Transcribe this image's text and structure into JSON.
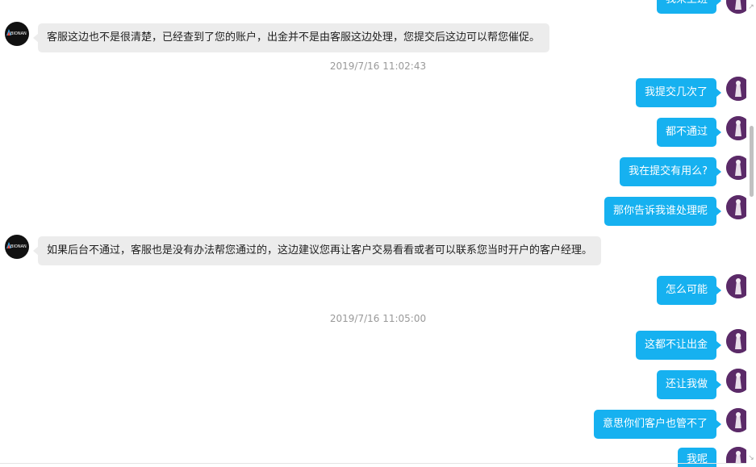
{
  "messages": [
    {
      "side": "out",
      "text": "我来上班"
    },
    {
      "side": "in",
      "text": "客服这边也不是很清楚，已经查到了您的账户，出金并不是由客服这边处理，您提交后这边可以帮您催促。"
    },
    {
      "side": "out",
      "text": "我提交几次了"
    },
    {
      "side": "out",
      "text": "都不通过"
    },
    {
      "side": "out",
      "text": "我在提交有用么?"
    },
    {
      "side": "out",
      "text": "那你告诉我谁处理呢"
    },
    {
      "side": "in",
      "text": "如果后台不通过，客服也是没有办法帮您通过的，这边建议您再让客户交易看看或者可以联系您当时开户的客户经理。"
    },
    {
      "side": "out",
      "text": "怎么可能"
    },
    {
      "side": "out",
      "text": "这都不让出金"
    },
    {
      "side": "out",
      "text": "还让我做"
    },
    {
      "side": "out",
      "text": "意思你们客户也管不了"
    },
    {
      "side": "out",
      "text": "我呢"
    }
  ],
  "timestamps": [
    "2019/7/16 11:02:43",
    "2019/7/16 11:05:00"
  ],
  "agent_avatar_text": "BIONAN",
  "icons": {
    "agent_avatar": "company-logo-icon",
    "user_avatar": "user-avatar-icon",
    "scroll_up": "scroll-up-arrow-icon",
    "scroll_down": "scroll-down-arrow-icon"
  },
  "colors": {
    "outgoing_bubble": "#16b1f0",
    "incoming_bubble": "#ececec",
    "timestamp_text": "#999999"
  }
}
